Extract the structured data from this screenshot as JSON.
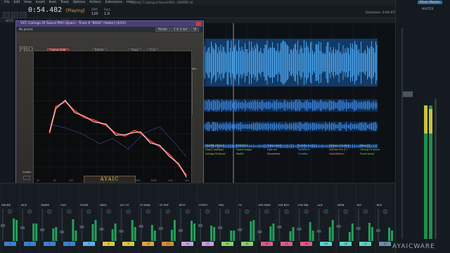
{
  "menu": [
    "File",
    "Edit",
    "View",
    "Insert",
    "Item",
    "Track",
    "Options",
    "Actions",
    "Extensions",
    "Help"
  ],
  "project_title": "[Edit] 7 Ceiling of Sound PRO - REAPER v6",
  "transport": {
    "time": "0:54.482",
    "status": "[Playing]",
    "bpm_label": "BPM",
    "bpm": "120",
    "rate_label": "Rate",
    "rate": "1.0"
  },
  "info_bar": "NOTE: all_Audio_and_Stems_BPM_120_TEMPO_VER.rpp",
  "selection": {
    "label": "Selection:",
    "start": "3:04.975",
    "end": "3:04.975",
    "len": "0:00.000"
  },
  "mixer_master_title": "Mixer Master",
  "master_label": "MASTER",
  "plugin": {
    "title": "VST: Ceilings Of Sound PRO (Ayaic) - Track 8 \"BASS\" [folder] [4/10]",
    "preset": "No preset",
    "param_btn": "Param",
    "io_btn": "2 in 2 out",
    "ui_btn": "UI",
    "pro_logo": "PRO",
    "buttons": {
      "ceiling_edit": "Ceiling Edit",
      "empty": "Empty",
      "save": "Save",
      "live": "Live",
      "eq_bypass": "EQ Bypass",
      "conform": "Conform spectrum to Ceiling",
      "auto_generate": "Auto Generate Ceiling",
      "mode": "BAR 2",
      "db_value": "+0 dB"
    },
    "out_gain_label": "Out Gain",
    "guides_label": "Guides",
    "freq_ticks": [
      "20",
      "50",
      "100",
      "200",
      "500",
      "1000",
      "2000",
      "5000",
      "10k",
      "20k"
    ],
    "brand_name": "AYAIC",
    "brand_sub": "Ceilings Of Sound"
  },
  "channels": [
    {
      "name": "DRUMS",
      "num": "1",
      "color": "#3f7fd0"
    },
    {
      "name": "KICK",
      "num": "2",
      "color": "#3f7fd0"
    },
    {
      "name": "SNARE",
      "num": "3",
      "color": "#3f7fd0"
    },
    {
      "name": "OVH",
      "num": "4",
      "color": "#3f7fd0"
    },
    {
      "name": "ROOM",
      "num": "5",
      "color": "#5fb0e8"
    },
    {
      "name": "BASS",
      "num": "8",
      "color": "#e0c34a"
    },
    {
      "name": "ACC GT",
      "num": "9",
      "color": "#e0c34a"
    },
    {
      "name": "GT MAIN",
      "num": "10",
      "color": "#e0a34a"
    },
    {
      "name": "GT RHY",
      "num": "11",
      "color": "#d88a3c"
    },
    {
      "name": "KEYS",
      "num": "12",
      "color": "#c9a0e0"
    },
    {
      "name": "SYNTH",
      "num": "13",
      "color": "#c9a0e0"
    },
    {
      "name": "PAD",
      "num": "14",
      "color": "#8ad06a"
    },
    {
      "name": "FX",
      "num": "15",
      "color": "#8ad06a"
    },
    {
      "name": "VOX MAIN",
      "num": "16",
      "color": "#e05a8a"
    },
    {
      "name": "VOX BGV",
      "num": "17",
      "color": "#e05a8a"
    },
    {
      "name": "VOX DBL",
      "num": "18",
      "color": "#e05a8a"
    },
    {
      "name": "AUX",
      "num": "19",
      "color": "#5fd0c8"
    },
    {
      "name": "VERB",
      "num": "20",
      "color": "#5fd0c8"
    },
    {
      "name": "DLY",
      "num": "21",
      "color": "#5fd0c8"
    },
    {
      "name": "BUS",
      "num": "22",
      "color": "#6f8fa8"
    }
  ],
  "fx_list": [
    [
      "FabFilter Pro-Q 3",
      "Trash2 (Izotope)",
      "Ceilings Of Sound"
    ],
    [
      "SUBSPACE",
      "Ozone Imager",
      "ReaEQ"
    ],
    [
      "TrackControl",
      "Fresh Air",
      "Decapitator"
    ],
    [
      "FabFilter Pro-C 2",
      "SUBSPACE",
      "EchoBoy"
    ],
    [
      "Ceilings Of Sound",
      "FabFilter Pro-Q 3",
      "ValhallaRoom"
    ],
    [
      "Saturn 2",
      "Ceilings Of Sound",
      "TrackControl"
    ]
  ],
  "watermark": "AYAICWARE",
  "colors": {
    "waveform": "#3b7fd3",
    "waveform_bright": "#4aa3ea",
    "ceiling_curve": "#e23a3a",
    "spectrum_curve": "#f2f2f2",
    "ref_curve": "#4b5fc8",
    "plugin_frame": "#6b5a9e"
  }
}
